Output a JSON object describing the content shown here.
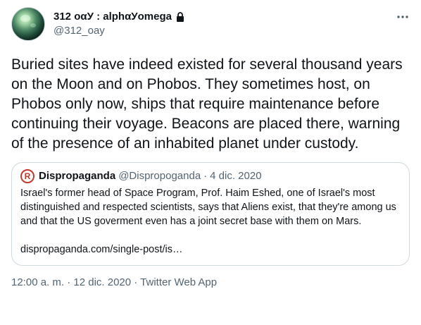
{
  "author": {
    "display_name": "312 oαУ : alphαУomega",
    "handle": "@312_oay",
    "avatar_icon": "planet-avatar",
    "protected_icon": "lock-icon"
  },
  "tweet": {
    "text": "Buried sites have indeed existed for several thousand years on the Moon and on Phobos. They sometimes host, on Phobos only now, ships that require maintenance before continuing their voyage. Beacons are placed there, warning of the presence of an inhabited planet under custody.",
    "more_icon": "more-options-icon"
  },
  "quote": {
    "avatar_letter": "R",
    "name": "Dispropaganda",
    "handle": "@Dispropoganda",
    "separator": "·",
    "date": "4 dic. 2020",
    "text": "Israel's former head of Space Program, Prof. Haim Eshed, one of Israel's most distinguished and respected scientists, says that Aliens exist, that they're among us and that the US goverment even has a joint secret base with them on Mars.",
    "link": "dispropaganda.com/single-post/is…"
  },
  "footer": {
    "text": "12:00 a. m. · 12 dic. 2020 · Twitter Web App"
  },
  "colors": {
    "text_primary": "#0f1419",
    "text_secondary": "#536471",
    "border": "#cfd9de",
    "quote_avatar": "#c0392b"
  }
}
